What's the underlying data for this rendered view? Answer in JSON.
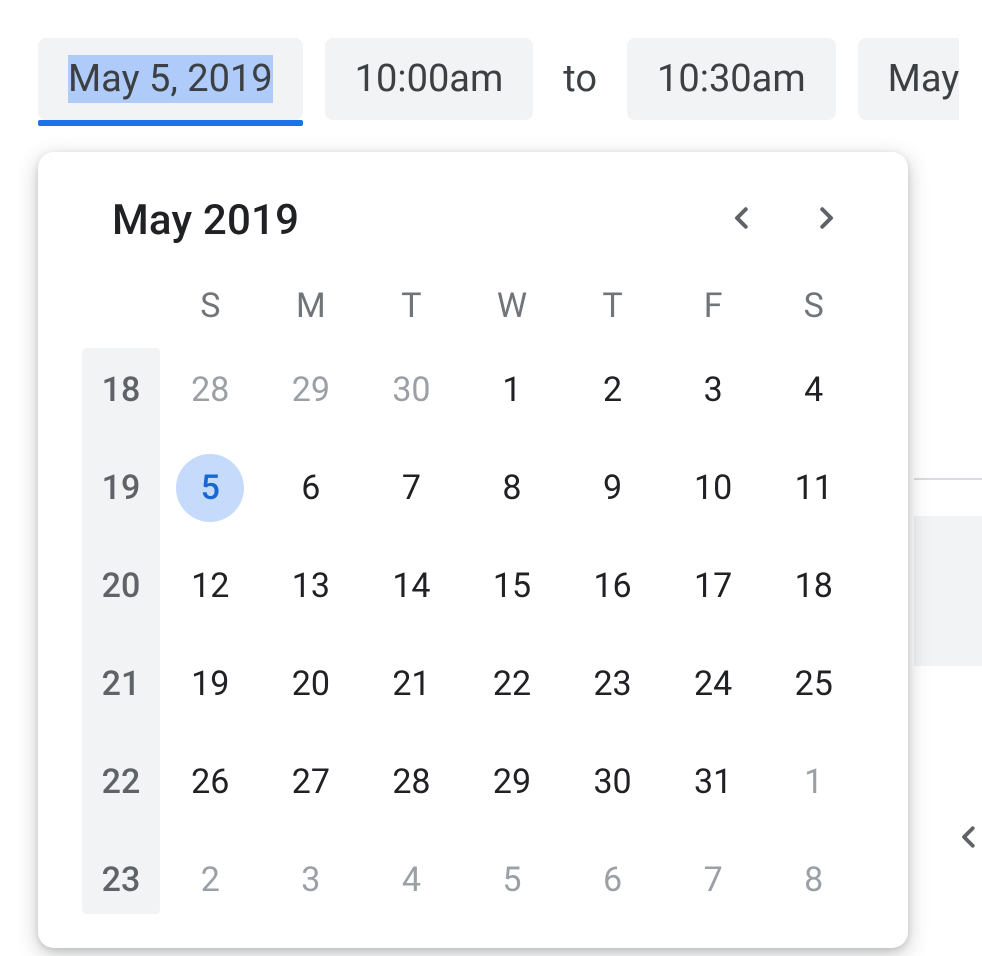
{
  "chips": {
    "start_date": "May 5, 2019",
    "start_time": "10:00am",
    "to_label": "to",
    "end_time": "10:30am",
    "end_date_partial": "May"
  },
  "calendar": {
    "title": "May 2019",
    "dow": [
      "S",
      "M",
      "T",
      "W",
      "T",
      "F",
      "S"
    ],
    "selected_day": 5,
    "rows": [
      {
        "wk": "18",
        "days": [
          {
            "n": "28",
            "other": true
          },
          {
            "n": "29",
            "other": true
          },
          {
            "n": "30",
            "other": true
          },
          {
            "n": "1"
          },
          {
            "n": "2"
          },
          {
            "n": "3"
          },
          {
            "n": "4"
          }
        ]
      },
      {
        "wk": "19",
        "days": [
          {
            "n": "5",
            "selected": true
          },
          {
            "n": "6"
          },
          {
            "n": "7"
          },
          {
            "n": "8"
          },
          {
            "n": "9"
          },
          {
            "n": "10"
          },
          {
            "n": "11"
          }
        ]
      },
      {
        "wk": "20",
        "days": [
          {
            "n": "12"
          },
          {
            "n": "13"
          },
          {
            "n": "14"
          },
          {
            "n": "15"
          },
          {
            "n": "16"
          },
          {
            "n": "17"
          },
          {
            "n": "18"
          }
        ]
      },
      {
        "wk": "21",
        "days": [
          {
            "n": "19"
          },
          {
            "n": "20"
          },
          {
            "n": "21"
          },
          {
            "n": "22"
          },
          {
            "n": "23"
          },
          {
            "n": "24"
          },
          {
            "n": "25"
          }
        ]
      },
      {
        "wk": "22",
        "days": [
          {
            "n": "26"
          },
          {
            "n": "27"
          },
          {
            "n": "28"
          },
          {
            "n": "29"
          },
          {
            "n": "30"
          },
          {
            "n": "31"
          },
          {
            "n": "1",
            "other": true
          }
        ]
      },
      {
        "wk": "23",
        "days": [
          {
            "n": "2",
            "other": true
          },
          {
            "n": "3",
            "other": true
          },
          {
            "n": "4",
            "other": true
          },
          {
            "n": "5",
            "other": true
          },
          {
            "n": "6",
            "other": true
          },
          {
            "n": "7",
            "other": true
          },
          {
            "n": "8",
            "other": true
          }
        ]
      }
    ]
  }
}
